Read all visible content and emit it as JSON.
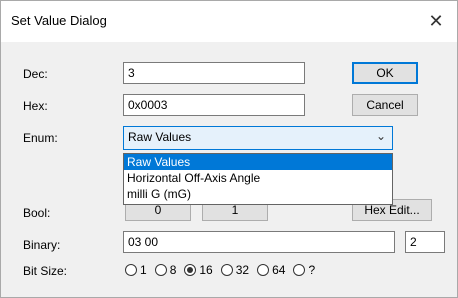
{
  "window": {
    "title": "Set Value Dialog",
    "close_glyph": "✕"
  },
  "labels": {
    "dec": "Dec:",
    "hex": "Hex:",
    "enum": "Enum:",
    "bool": "Bool:",
    "binary": "Binary:",
    "bitsize": "Bit Size:"
  },
  "fields": {
    "dec": "3",
    "hex": "0x0003",
    "binary": "03 00",
    "binary_len": "2"
  },
  "buttons": {
    "ok": "OK",
    "cancel": "Cancel",
    "bool_false": "0",
    "bool_true": "1",
    "hex_edit": "Hex Edit..."
  },
  "enum": {
    "selected": "Raw Values",
    "options": [
      "Raw Values",
      "Horizontal Off-Axis Angle",
      "milli G (mG)"
    ]
  },
  "bit_size": {
    "options": [
      "1",
      "8",
      "16",
      "32",
      "64",
      "?"
    ],
    "selected": "16"
  },
  "colors": {
    "accent": "#0078d7",
    "dialog_bg": "#f0f0f0"
  }
}
